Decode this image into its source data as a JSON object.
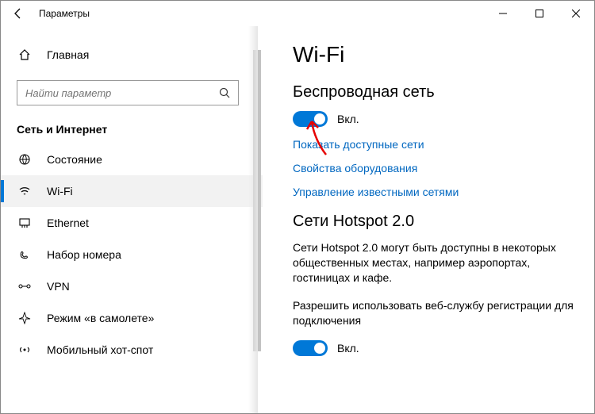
{
  "window": {
    "title": "Параметры"
  },
  "sidebar": {
    "home": "Главная",
    "search_placeholder": "Найти параметр",
    "category": "Сеть и Интернет",
    "items": [
      {
        "label": "Состояние"
      },
      {
        "label": "Wi-Fi"
      },
      {
        "label": "Ethernet"
      },
      {
        "label": "Набор номера"
      },
      {
        "label": "VPN"
      },
      {
        "label": "Режим «в самолете»"
      },
      {
        "label": "Мобильный хот-спот"
      }
    ]
  },
  "main": {
    "title": "Wi-Fi",
    "wireless": {
      "heading": "Беспроводная сеть",
      "toggle_label": "Вкл."
    },
    "links": {
      "show_networks": "Показать доступные сети",
      "hw_properties": "Свойства оборудования",
      "manage_known": "Управление известными сетями"
    },
    "hotspot": {
      "heading": "Сети Hotspot 2.0",
      "desc": "Сети Hotspot 2.0 могут быть доступны в некоторых общественных местах, например аэропортах, гостиницах и кафе.",
      "allow": "Разрешить использовать веб-службу регистрации для подключения",
      "toggle_label": "Вкл."
    }
  }
}
